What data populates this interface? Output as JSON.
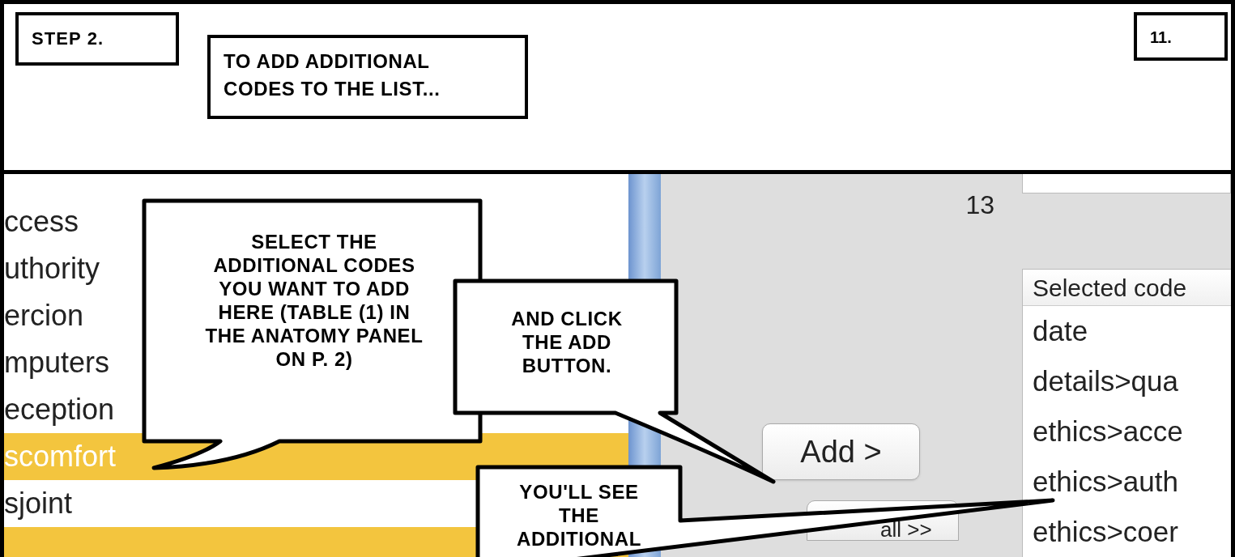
{
  "step_label": "STEP 2.",
  "caption": "TO ADD ADDITIONAL\nCODES TO THE LIST...",
  "page_number": "11.",
  "code_list": {
    "rows": [
      {
        "label": "ccess",
        "selected": false
      },
      {
        "label": "uthority",
        "selected": false
      },
      {
        "label": "ercion",
        "selected": false
      },
      {
        "label": "mputers",
        "selected": false
      },
      {
        "label": "eception",
        "selected": false
      },
      {
        "label": "scomfort",
        "selected": true
      },
      {
        "label": "sjoint",
        "selected": false
      },
      {
        "selected": true
      }
    ]
  },
  "row_number": "13",
  "buttons": [
    {
      "label": "Add >"
    },
    {
      "label": "all >>"
    }
  ],
  "selected_codes": {
    "header": "Selected code",
    "rows": [
      "date",
      "details>qua",
      "ethics>acce",
      "ethics>auth",
      "ethics>coer"
    ]
  },
  "callouts": [
    {
      "text": "SELECT THE\nADDITIONAL CODES\nYOU WANT TO ADD\nHERE (TABLE (1) IN\nTHE ANATOMY PANEL\nON P. 2)"
    },
    {
      "text": "AND CLICK\nTHE ADD\nBUTTON."
    },
    {
      "text": "YOU'LL SEE\nTHE\nADDITIONAL"
    }
  ]
}
